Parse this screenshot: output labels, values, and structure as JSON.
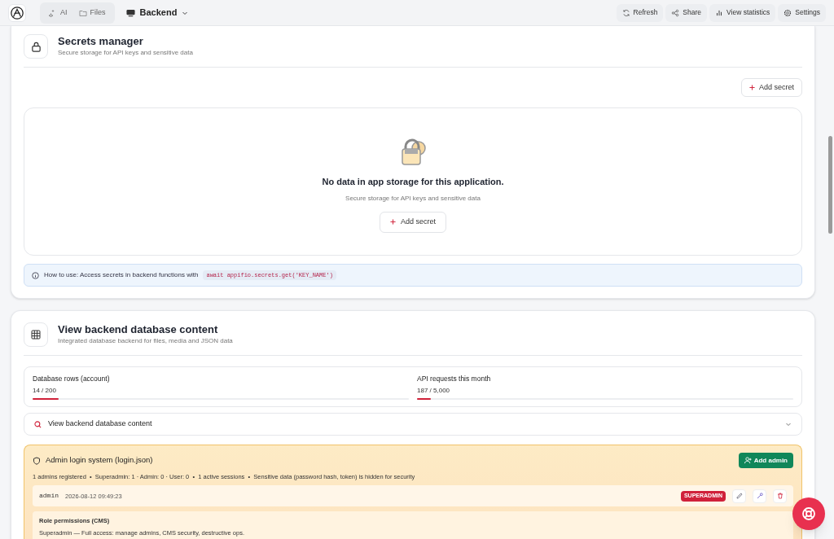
{
  "toolbar": {
    "tabs": [
      {
        "label": "AI",
        "kind": "sparkle",
        "selected": false
      },
      {
        "label": "Files",
        "kind": "folder",
        "selected": false
      }
    ],
    "project": "Backend",
    "actions": [
      {
        "label": "Refresh",
        "kind": "refresh"
      },
      {
        "label": "Share",
        "kind": "share"
      },
      {
        "label": "View statistics",
        "kind": "chart"
      },
      {
        "label": "Settings",
        "kind": "gear"
      }
    ]
  },
  "secrets": {
    "title": "Secrets manager",
    "subtitle": "Secure storage for API keys and sensitive data",
    "add_button": "Add secret",
    "empty": {
      "title": "No data in app storage for this application.",
      "subtitle": "Secure storage for API keys and sensitive data",
      "button": "Add secret"
    },
    "info": {
      "label": "How to use:",
      "text": "Access secrets in backend functions with",
      "code": "await appifio.secrets.get('KEY_NAME')"
    }
  },
  "database": {
    "title": "View backend database content",
    "subtitle": "Integrated database backend for files, media and JSON data",
    "meters": [
      {
        "label": "Database rows (account)",
        "reading": "14 / 200",
        "level": 0.07
      },
      {
        "label": "API requests this month",
        "reading": "187 / 5,000",
        "level": 0.037
      }
    ],
    "browser": {
      "label": "View backend database content",
      "expanded": false
    },
    "admin": {
      "title": "Admin login system (login.json)",
      "button": "Add admin",
      "summary": "1 admins registered  •  Superadmin: 1 · Admin: 0 · User: 0  •  1 active sessions  •  Sensitive data (password hash, token) is hidden for security",
      "users": [
        {
          "name": "admin",
          "date": "2026-08-12 09:49:23",
          "role": "SUPERADMIN"
        }
      ],
      "permissions": {
        "title": "Role permissions (CMS)",
        "line": "Superadmin — Full access: manage admins, CMS security, destructive ops."
      }
    }
  }
}
